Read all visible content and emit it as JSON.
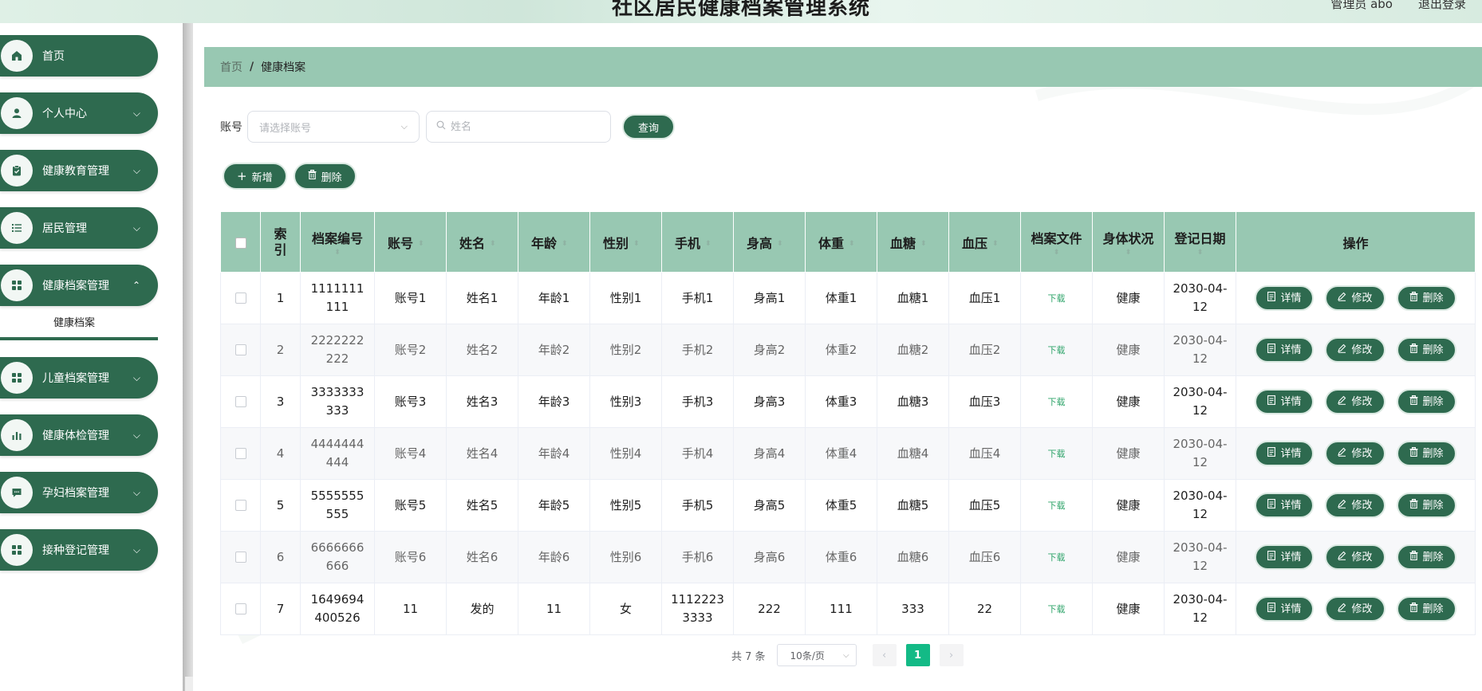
{
  "header": {
    "title": "社区居民健康档案管理系统",
    "admin_label": "管理员 abo",
    "logout_label": "退出登录"
  },
  "sidebar": {
    "items": [
      {
        "label": "首页",
        "icon": "home-icon"
      },
      {
        "label": "个人中心",
        "icon": "user-icon"
      },
      {
        "label": "健康教育管理",
        "icon": "clipboard-icon"
      },
      {
        "label": "居民管理",
        "icon": "list-icon"
      },
      {
        "label": "健康档案管理",
        "icon": "grid-icon"
      },
      {
        "label": "儿童档案管理",
        "icon": "grid-icon"
      },
      {
        "label": "健康体检管理",
        "icon": "bar-chart-icon"
      },
      {
        "label": "孕妇档案管理",
        "icon": "message-icon"
      },
      {
        "label": "接种登记管理",
        "icon": "grid-icon"
      }
    ],
    "submenu_active": "健康档案"
  },
  "breadcrumb": {
    "home": "首页",
    "separator": "/",
    "current": "健康档案"
  },
  "search": {
    "account_label": "账号",
    "account_placeholder": "请选择账号",
    "name_placeholder": "姓名",
    "query_button": "查询"
  },
  "actions": {
    "add_label": "新增",
    "delete_label": "删除"
  },
  "table": {
    "headers": [
      "索引",
      "档案编号",
      "账号",
      "姓名",
      "年龄",
      "性别",
      "手机",
      "身高",
      "体重",
      "血糖",
      "血压",
      "档案文件",
      "身体状况",
      "登记日期",
      "操作"
    ],
    "download_label": "下载",
    "detail_label": "详情",
    "edit_label": "修改",
    "delete_label": "删除",
    "rows": [
      {
        "index": "1",
        "file_no": "1111111111",
        "account": "账号1",
        "name": "姓名1",
        "age": "年龄1",
        "gender": "性别1",
        "phone": "手机1",
        "height": "身高1",
        "weight": "体重1",
        "sugar": "血糖1",
        "pressure": "血压1",
        "status": "健康",
        "date": "2030-04-12"
      },
      {
        "index": "2",
        "file_no": "2222222222",
        "account": "账号2",
        "name": "姓名2",
        "age": "年龄2",
        "gender": "性别2",
        "phone": "手机2",
        "height": "身高2",
        "weight": "体重2",
        "sugar": "血糖2",
        "pressure": "血压2",
        "status": "健康",
        "date": "2030-04-12"
      },
      {
        "index": "3",
        "file_no": "3333333333",
        "account": "账号3",
        "name": "姓名3",
        "age": "年龄3",
        "gender": "性别3",
        "phone": "手机3",
        "height": "身高3",
        "weight": "体重3",
        "sugar": "血糖3",
        "pressure": "血压3",
        "status": "健康",
        "date": "2030-04-12"
      },
      {
        "index": "4",
        "file_no": "4444444444",
        "account": "账号4",
        "name": "姓名4",
        "age": "年龄4",
        "gender": "性别4",
        "phone": "手机4",
        "height": "身高4",
        "weight": "体重4",
        "sugar": "血糖4",
        "pressure": "血压4",
        "status": "健康",
        "date": "2030-04-12"
      },
      {
        "index": "5",
        "file_no": "5555555555",
        "account": "账号5",
        "name": "姓名5",
        "age": "年龄5",
        "gender": "性别5",
        "phone": "手机5",
        "height": "身高5",
        "weight": "体重5",
        "sugar": "血糖5",
        "pressure": "血压5",
        "status": "健康",
        "date": "2030-04-12"
      },
      {
        "index": "6",
        "file_no": "6666666666",
        "account": "账号6",
        "name": "姓名6",
        "age": "年龄6",
        "gender": "性别6",
        "phone": "手机6",
        "height": "身高6",
        "weight": "体重6",
        "sugar": "血糖6",
        "pressure": "血压6",
        "status": "健康",
        "date": "2030-04-12"
      },
      {
        "index": "7",
        "file_no": "1649694400526",
        "account": "11",
        "name": "发的",
        "age": "11",
        "gender": "女",
        "phone": "11122233333",
        "height": "222",
        "weight": "111",
        "sugar": "333",
        "pressure": "22",
        "status": "健康",
        "date": "2030-04-12"
      }
    ]
  },
  "pagination": {
    "total_label": "共 7 条",
    "page_size": "10条/页",
    "current_page": "1"
  },
  "colors": {
    "primary": "#2e6a4f",
    "breadcrumb_bg": "#98c8b2",
    "page_active": "#13ba86"
  }
}
